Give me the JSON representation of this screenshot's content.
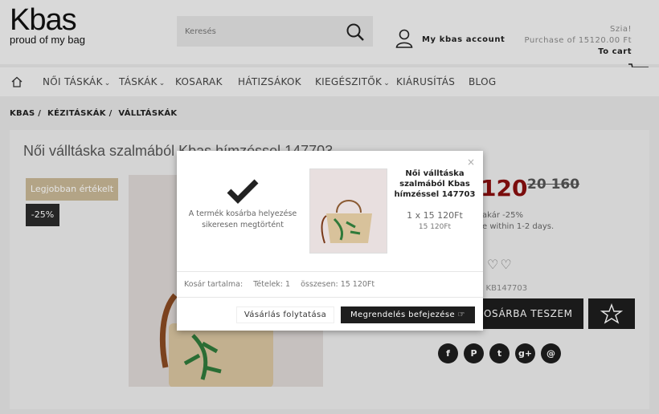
{
  "logo": {
    "name": "Kbas",
    "tagline": "proud of my bag"
  },
  "search": {
    "placeholder": "Keresés"
  },
  "account": {
    "label": "My kbas account"
  },
  "cart": {
    "greeting": "Szia!",
    "summary": "Purchase of 15120.00 Ft",
    "link": "To cart"
  },
  "nav": {
    "items": [
      {
        "label": "NŐI TÁSKÁK",
        "dropdown": true
      },
      {
        "label": "TÁSKÁK",
        "dropdown": true
      },
      {
        "label": "KOSARAK",
        "dropdown": false
      },
      {
        "label": "HÁTIZSÁKOK",
        "dropdown": false
      },
      {
        "label": "KIEGÉSZITŐK",
        "dropdown": true
      },
      {
        "label": "KIÁRUSÍTÁS",
        "dropdown": false
      },
      {
        "label": "BLOG",
        "dropdown": false
      }
    ]
  },
  "breadcrumb": [
    "KBAS /",
    "KÉZITÁSKÁK /",
    "VÁLLTÁSKÁK"
  ],
  "product": {
    "title": "Női válltáska szalmából Kbas hímzéssel 147703",
    "badge_best": "Legjobban értékelt",
    "badge_discount": "-25%",
    "price_new": "120",
    "price_old": "20 160",
    "discount_note_1": "akár -25%",
    "discount_note_2": "e within 1-2 days.",
    "sku": ": KB147703",
    "add_to_cart": "OSÁRBA TESZEM",
    "social": [
      "f",
      "P",
      "t",
      "g+",
      "@"
    ]
  },
  "modal": {
    "close": "×",
    "success_text": "A termék kosárba helyezése sikeresen megtörtént",
    "product_title": "Női válltáska szalmából Kbas hímzéssel 147703",
    "qty_line": "1 x 15 120Ft",
    "subtotal": "15 120Ft",
    "cart_label": "Kosár tartalma:",
    "items_label": "Tételek: 1",
    "total_label": "összesen: 15 120Ft",
    "btn_continue": "Vásárlás folytatása",
    "btn_checkout": "Megrendelés befejezése"
  },
  "colors": {
    "accent_price": "#8a0f0f",
    "badge_best": "#c8b796",
    "dark": "#1e1e1e"
  }
}
